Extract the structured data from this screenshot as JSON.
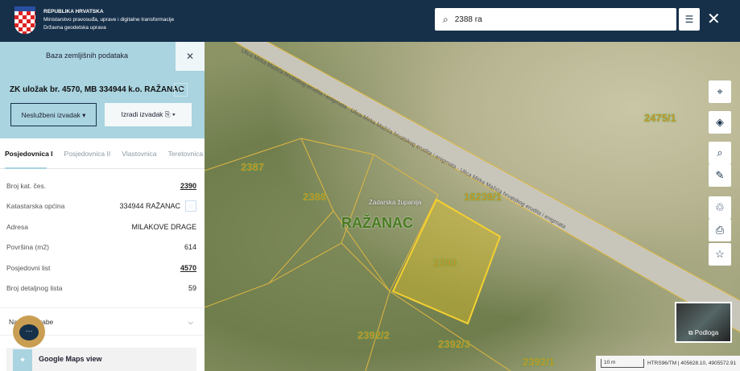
{
  "header": {
    "org_lines": [
      "REPUBLIKA HRVATSKA",
      "Ministarstvo pravosuđa, uprave i digitalne transformacije",
      "Državna geodetska uprava"
    ],
    "search_value": "2388 ra"
  },
  "panel": {
    "title": "Baza zemljišnih podataka",
    "heading": "ZK uložak br. 4570, MB 334944 k.o. RAŽANAC",
    "btn_unofficial": "Neslužbeni izvadak ▾",
    "btn_create": "Izradi izvadak ⎘ ▾",
    "tabs": [
      "Posjedovnica I",
      "Posjedovnica II",
      "Vlastovnica",
      "Teretovnica"
    ],
    "rows": [
      {
        "label": "Broj kat. čes.",
        "value": "2390"
      },
      {
        "label": "Katastarska općina",
        "value": "334944 RAŽANAC"
      },
      {
        "label": "Adresa",
        "value": "MILAKOVE DRAGE"
      },
      {
        "label": "Površina (m2)",
        "value": "614"
      },
      {
        "label": "Posjedovni list",
        "value": "4570"
      },
      {
        "label": "Broj detaljnog lista",
        "value": "59"
      }
    ],
    "accordion": "Način uporabe",
    "google": "Google Maps view"
  },
  "map": {
    "parcels": [
      "2387",
      "2388",
      "2390",
      "2392/2",
      "2392/3",
      "2392/1",
      "2475/1",
      "16239/1"
    ],
    "county": "Zadarska županija",
    "place": "RAŽANAC",
    "road": "Ulica Mirka Mažića hrvatskog erudita i enigmata · Ulica Mirka Mažića hrvatskog erudita i enigmata · Ulica Mirka Mažića hrvatskog erudita i enigmata",
    "basemap": "Podloga",
    "scale": "10 m",
    "coords": "HTRS96/TM | 405628.10, 4905572.91"
  }
}
